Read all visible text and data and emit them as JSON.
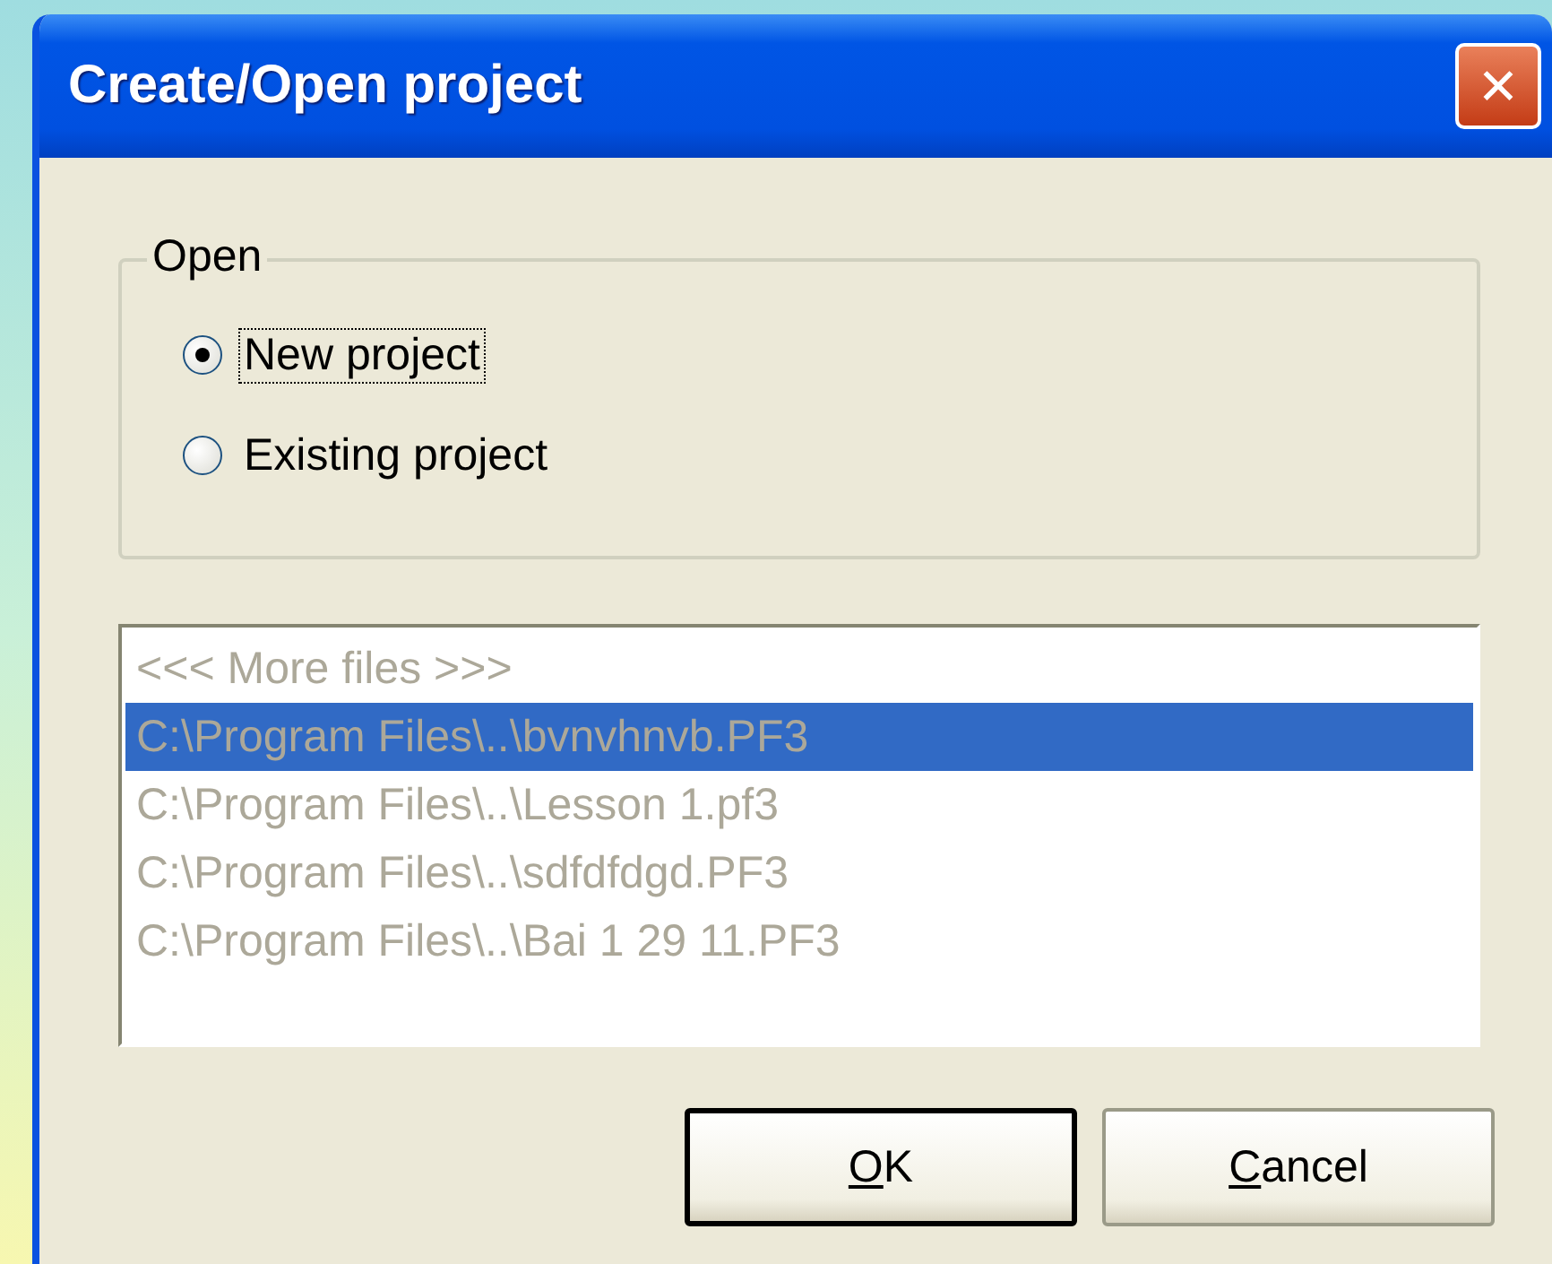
{
  "window": {
    "title": "Create/Open project",
    "close_glyph": "✕"
  },
  "group": {
    "label": "Open",
    "options": [
      {
        "label": "New project",
        "selected": true,
        "focused": true
      },
      {
        "label": "Existing project",
        "selected": false,
        "focused": false
      }
    ]
  },
  "file_list": {
    "disabled": true,
    "items": [
      {
        "text": "<<< More files >>>",
        "selected": false
      },
      {
        "text": "C:\\Program Files\\..\\bvnvhnvb.PF3",
        "selected": true
      },
      {
        "text": "C:\\Program Files\\..\\Lesson 1.pf3",
        "selected": false
      },
      {
        "text": "C:\\Program Files\\..\\sdfdfdgd.PF3",
        "selected": false
      },
      {
        "text": "C:\\Program Files\\..\\Bai 1 29 11.PF3",
        "selected": false
      }
    ]
  },
  "buttons": [
    {
      "access_char": "O",
      "rest": "K",
      "default": true
    },
    {
      "access_char": "C",
      "rest": "ancel",
      "default": false
    }
  ]
}
